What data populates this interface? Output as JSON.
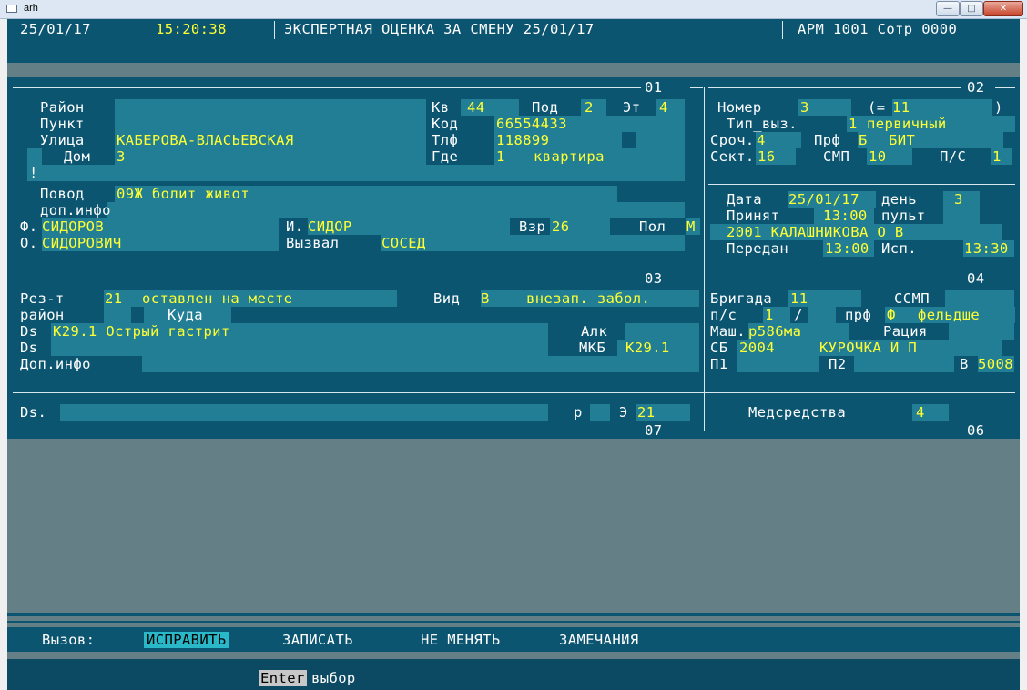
{
  "window": {
    "title": "arh"
  },
  "header": {
    "date": "25/01/17",
    "time": "15:20:38",
    "title": "ЭКСПЕРТНАЯ ОЦЕНКА ЗА СМЕНУ 25/01/17",
    "arm": "АРМ 1001 Сотр 0000"
  },
  "sections": {
    "s01": "01",
    "s02": "02",
    "s03": "03",
    "s04": "04",
    "s06": "06",
    "s07": "07"
  },
  "address": {
    "rayon_label": "Район",
    "punkt_label": "Пункт",
    "ulica_label": "Улица",
    "ulica": "КАБЕРОВА-ВЛАСЬЕВСКАЯ",
    "dom_label": "Дом",
    "dom": "3",
    "kv_label": "Кв",
    "kv": "44",
    "pod_label": "Под",
    "pod": "2",
    "et_label": "Эт",
    "et": "4",
    "kod_label": "Код",
    "kod": "66554433",
    "tlf_label": "Тлф",
    "tlf": "118899",
    "gde_label": "Где",
    "gde_code": "1",
    "gde": "квартира",
    "excl": "!"
  },
  "reason": {
    "povod_label": "Повод",
    "povod": "09Ж болит живот",
    "dop_label": "доп.инфо",
    "f_label": "Ф.",
    "f": "СИДОРОВ",
    "i_label": "И.",
    "i": "СИДОР",
    "vzr_label": "Взр",
    "vzr": "26",
    "pol_label": "Пол",
    "pol": "М",
    "o_label": "О.",
    "o": "СИДОРОВИЧ",
    "vyzval_label": "Вызвал",
    "vyzval": "СОСЕД"
  },
  "call": {
    "nomer_label": "Номер",
    "nomer": "3",
    "eq_open": "(=",
    "eq_val": "11",
    "eq_close": ")",
    "tip_label": "Тип_выз.",
    "tip_code": "1",
    "tip": "первичный",
    "sroch_label": "Сроч.",
    "sroch": "4",
    "prf_label": "Прф",
    "prf_code": "Б",
    "prf": "БИТ",
    "sekt_label": "Сект.",
    "sekt": "16",
    "smp_label": "СМП",
    "smp": "10",
    "ps_label": "П/С",
    "ps": "1"
  },
  "time_info": {
    "data_label": "Дата",
    "data": "25/01/17",
    "den_label": "день",
    "den": "3",
    "prinyat_label": "Принят",
    "prinyat": "13:00",
    "pult_label": "пульт",
    "operator": "2001 КАЛАШНИКОВА О В",
    "peredan_label": "Передан",
    "peredan": "13:00",
    "isp_label": "Исп.",
    "isp": "13:30"
  },
  "result": {
    "rez_label": "Рез-т",
    "rez_code": "21",
    "rez": "оставлен на месте",
    "vid_label": "Вид",
    "vid_code": "В",
    "vid": "внезап. забол.",
    "rayon_label": "район",
    "kuda_label": "Куда",
    "ds_label": "Ds",
    "ds": "K29.1 Острый гастрит",
    "alk_label": "Алк",
    "ds2_label": "Ds",
    "mkb_label": "МКБ",
    "mkb": "K29.1",
    "dop_label": "Доп.инфо"
  },
  "brigade": {
    "brig_label": "Бригада",
    "brig": "11",
    "ssmp_label": "ССМП",
    "ps_label": "п/с",
    "ps": "1",
    "slash": "/",
    "prf_label": "прф",
    "prf_code": "Ф",
    "prf": "фельдше",
    "mash_label": "Маш.",
    "mash": "р586ма",
    "raciya_label": "Рация",
    "sb_label": "СБ",
    "sb": "2004",
    "sb_name": "КУРОЧКА И П",
    "p1_label": "П1",
    "p2_label": "П2",
    "v_label": "В",
    "v": "5008"
  },
  "ds_row": {
    "ds_label": "Ds.",
    "r_label": "р",
    "e_label": "Э",
    "e": "21"
  },
  "meds": {
    "label": "Медсредства",
    "value": "4"
  },
  "menu": {
    "prefix": "Вызов:",
    "items": [
      "ИСПРАВИТЬ",
      "ЗАПИСАТЬ",
      "НЕ МЕНЯТЬ",
      "ЗАМЕЧАНИЯ"
    ]
  },
  "status": {
    "key": "Enter",
    "text": "выбор"
  },
  "colors": {
    "panel": "#0c5571",
    "field": "#217e94",
    "value": "#ffff33",
    "background": "#647f86"
  }
}
